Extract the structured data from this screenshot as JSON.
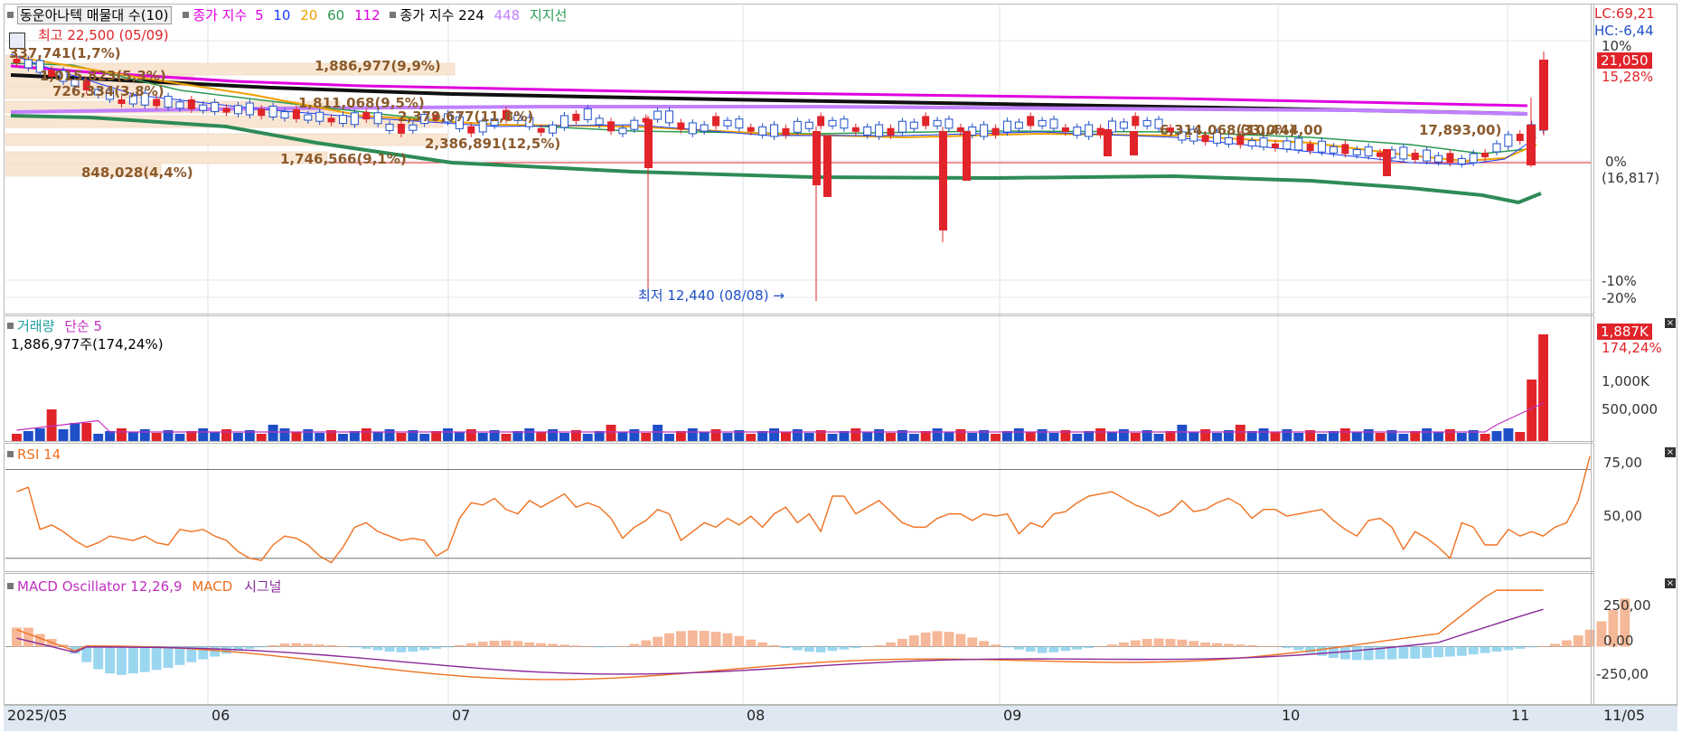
{
  "main_panel": {
    "stock_label": "동운아나텍 매물대 수(10)",
    "ma_label": "종가 지수",
    "ma_periods": [
      "5",
      "10",
      "20",
      "60",
      "112"
    ],
    "ma_colors": [
      "#e000e0",
      "#1a3cff",
      "#f0a000",
      "#2a9a50",
      "#e000e0"
    ],
    "long_ma_label": "종가 지수 224",
    "long_ma_extra": "448",
    "support_label": "지지선",
    "high_label": "최고 22,500 (05/09)",
    "low_label": "최저 12,440 (08/08)",
    "lc_label": "LC:69,21",
    "hc_label": "HC:-6,44",
    "price_tag": "21,050",
    "price_pct": "15,28%",
    "right_axis": [
      "10%",
      "0%",
      "(16,817)",
      "-10%",
      "-20%"
    ],
    "volume_profile": [
      {
        "label": "337,741(1,7%)"
      },
      {
        "label": "1,886,977(9,9%)"
      },
      {
        "label": "1,015,823(5,3%)"
      },
      {
        "label": "726,334(3,8%)"
      },
      {
        "label": "1,811,068(9,5%)"
      },
      {
        "label": "2,379,677(11,8%)"
      },
      {
        "label": "2,386,891(12,5%)"
      },
      {
        "label": "1,746,566(9,1%)"
      },
      {
        "label": "848,028(4,4%)"
      },
      {
        "label": "6,314,068(33,0%)"
      }
    ],
    "extra_labels": [
      "(10,444,00",
      "17,893,00)"
    ]
  },
  "volume_panel": {
    "title": "거래량",
    "ma_label": "단순 5",
    "current": "1,886,977주(174,24%)",
    "tag": "1,887K",
    "tag_pct": "174,24%",
    "right_axis": [
      "1,000K",
      "500,000"
    ]
  },
  "rsi_panel": {
    "title": "RSI 14",
    "right_axis": [
      "75,00",
      "50,00"
    ]
  },
  "macd_panel": {
    "title": "MACD Oscillator 12,26,9",
    "macd_label": "MACD",
    "signal_label": "시그널",
    "right_axis": [
      "250,00",
      "0,00",
      "-250,00"
    ]
  },
  "x_axis": [
    "2025/05",
    "06",
    "07",
    "08",
    "09",
    "10",
    "11",
    "11/05"
  ],
  "colors": {
    "up": "#e0242a",
    "down": "#1f4fc8",
    "ma224": "#111111",
    "support": "#2e8b57",
    "rsi": "#f07020",
    "macd": "#f07020",
    "signal": "#8a2a9a",
    "osc_pos": "#f5b898",
    "osc_neg": "#9ad6f0",
    "vol_ma": "#c030c0"
  },
  "chart_data": [
    {
      "type": "candlestick",
      "title": "동운아나텍 매물대 수(10)",
      "x_range": [
        "2025/05/02",
        "2025/11/05"
      ],
      "ylim": [
        12000,
        23000
      ],
      "summary": {
        "high": 22500,
        "high_date": "05/09",
        "low": 12440,
        "low_date": "08/08",
        "last_close": 21050,
        "last_change_pct": 15.28,
        "base_price": 16817
      },
      "volume_profile": [
        337741,
        1886977,
        1015823,
        726334,
        1811068,
        2379677,
        2386891,
        1746566,
        848028,
        6314068
      ]
    },
    {
      "type": "bar",
      "title": "거래량",
      "last_value": 1886977,
      "last_pct": 174.24,
      "ylim": [
        0,
        2000000
      ]
    },
    {
      "type": "line",
      "title": "RSI 14",
      "ylim": [
        25,
        80
      ],
      "levels": [
        70,
        30
      ],
      "values": [
        60,
        62,
        43,
        45,
        42,
        38,
        35,
        37,
        40,
        39,
        38,
        40,
        37,
        36,
        43,
        42,
        43,
        40,
        38,
        33,
        30,
        29,
        36,
        40,
        39,
        36,
        31,
        28,
        35,
        44,
        46,
        42,
        40,
        38,
        39,
        38,
        31,
        34,
        48,
        55,
        54,
        57,
        52,
        50,
        56,
        53,
        56,
        59,
        53,
        55,
        53,
        48,
        39,
        44,
        47,
        52,
        50,
        38,
        42,
        46,
        44,
        48,
        45,
        49,
        44,
        50,
        53,
        46,
        50,
        42,
        58,
        58,
        50,
        53,
        56,
        51,
        46,
        44,
        44,
        48,
        50,
        50,
        47,
        50,
        49,
        50,
        41,
        46,
        44,
        50,
        51,
        55,
        58,
        59,
        60,
        57,
        54,
        52,
        49,
        51,
        56,
        51,
        52,
        55,
        57,
        54,
        48,
        52,
        52,
        49,
        50,
        51,
        52,
        47,
        43,
        40,
        47,
        48,
        44,
        34,
        42,
        39,
        35,
        30,
        46,
        44,
        36,
        36,
        43,
        40,
        42,
        40,
        44,
        46,
        56,
        76
      ]
    },
    {
      "type": "bar",
      "title": "MACD Oscillator 12,26,9",
      "ylim": [
        -400,
        420
      ],
      "osc": [
        135,
        135,
        90,
        55,
        15,
        -50,
        -110,
        -160,
        -190,
        -200,
        -190,
        -180,
        -165,
        -150,
        -130,
        -110,
        -90,
        -70,
        -50,
        -30,
        -15,
        -5,
        10,
        22,
        25,
        20,
        15,
        10,
        5,
        -5,
        -15,
        -25,
        -35,
        -40,
        -35,
        -25,
        -15,
        -5,
        10,
        25,
        35,
        42,
        44,
        40,
        30,
        25,
        20,
        14,
        8,
        0,
        -5,
        -3,
        5,
        20,
        45,
        70,
        95,
        110,
        115,
        112,
        105,
        95,
        75,
        50,
        30,
        10,
        -10,
        -25,
        -35,
        -40,
        -30,
        -20,
        -10,
        0,
        10,
        30,
        55,
        80,
        100,
        110,
        105,
        90,
        65,
        40,
        15,
        -5,
        -20,
        -35,
        -45,
        -40,
        -30,
        -20,
        -10,
        0,
        15,
        30,
        45,
        55,
        58,
        55,
        50,
        40,
        30,
        25,
        20,
        15,
        10,
        5,
        0,
        -10,
        -25,
        -45,
        -65,
        -80,
        -90,
        -95,
        -95,
        -90,
        -90,
        -85,
        -85,
        -80,
        -75,
        -70,
        -65,
        -55,
        -45,
        -35,
        -25,
        -15,
        -5,
        5,
        20,
        45,
        80,
        120,
        180,
        260,
        340
      ]
    }
  ]
}
